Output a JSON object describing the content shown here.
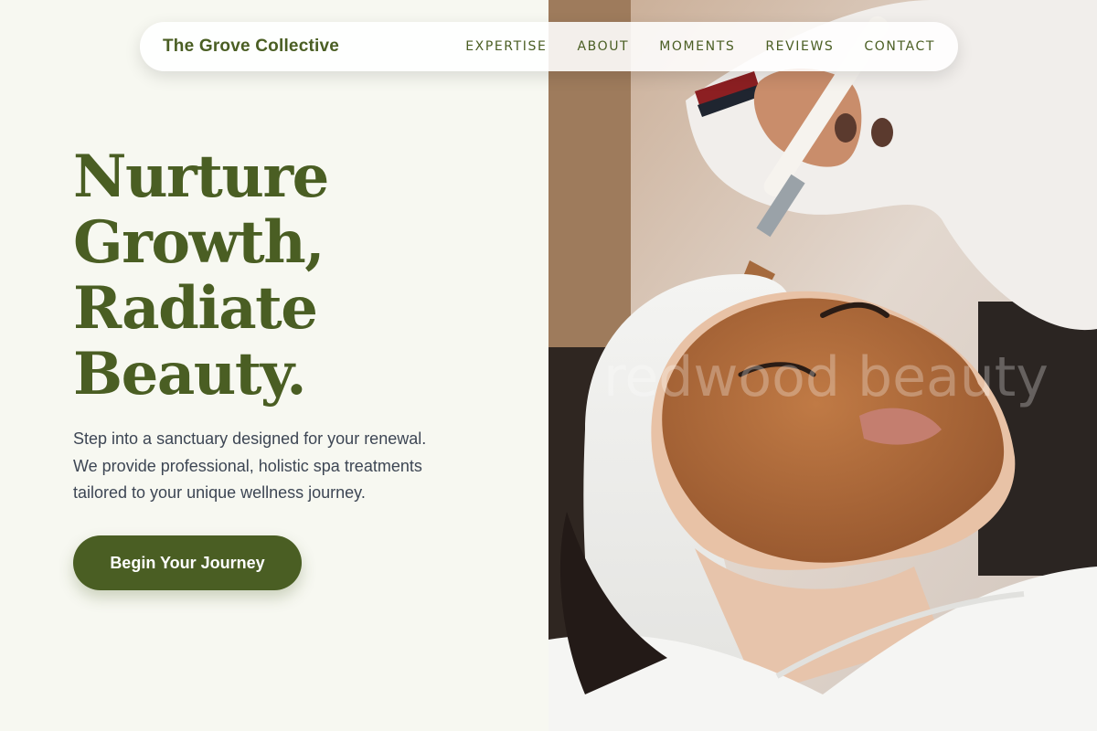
{
  "nav": {
    "brand": "The Grove Collective",
    "links": [
      "EXPERTISE",
      "ABOUT",
      "MOMENTS",
      "REVIEWS",
      "CONTACT"
    ]
  },
  "hero": {
    "headline": [
      "Nurture",
      "Growth,",
      "Radiate",
      "Beauty."
    ],
    "subtitle_lines": [
      "Step into a sanctuary designed for your renewal.",
      "We provide professional, holistic spa treatments",
      "tailored to your unique wellness journey."
    ],
    "cta_label": "Begin Your Journey",
    "image_watermark": "redwood beauty"
  },
  "colors": {
    "accent": "#4a5e23",
    "background": "#f7f8f1",
    "body_text": "#3d4654",
    "button_text": "#ffffff"
  }
}
